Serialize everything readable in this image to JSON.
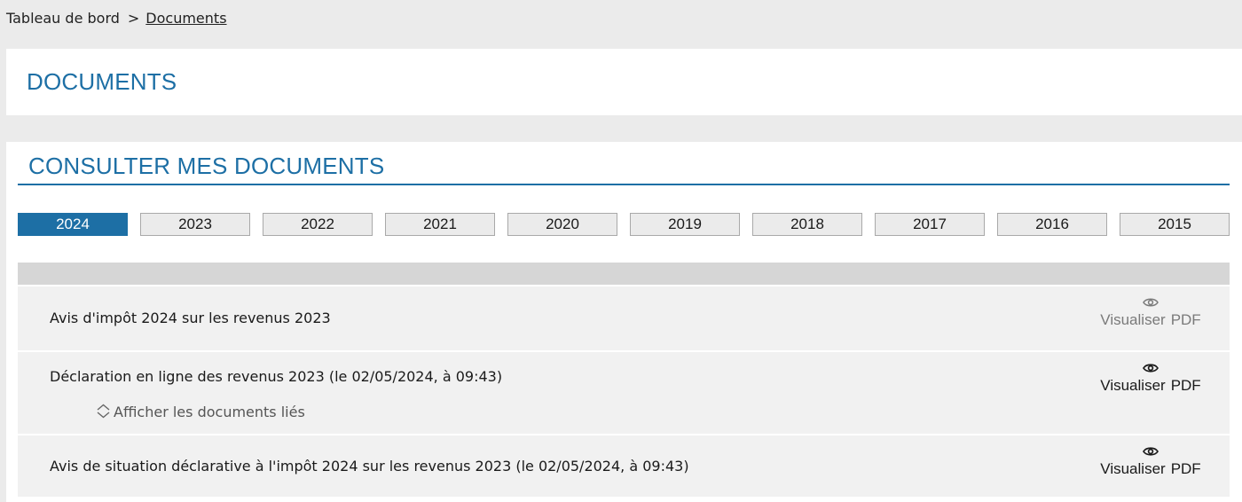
{
  "breadcrumb": {
    "home": "Tableau de bord",
    "separator": ">",
    "current": "Documents"
  },
  "page": {
    "title": "DOCUMENTS"
  },
  "section": {
    "title": "CONSULTER MES DOCUMENTS"
  },
  "years": {
    "active": "2024",
    "tabs": [
      "2024",
      "2023",
      "2022",
      "2021",
      "2020",
      "2019",
      "2018",
      "2017",
      "2016",
      "2015"
    ]
  },
  "documents": [
    {
      "title": "Avis d'impôt 2024 sur les revenus 2023",
      "action_label": "Visualiser",
      "format_label": "PDF",
      "icon": "eye-icon"
    },
    {
      "title": "Déclaration en ligne des revenus 2023 (le 02/05/2024, à 09:43)",
      "action_label": "Visualiser",
      "format_label": "PDF",
      "icon": "eye-icon",
      "related_label": "Afficher les documents liés",
      "related_icon": "expand-icon"
    },
    {
      "title": "Avis de situation déclarative à l'impôt 2024 sur les revenus 2023 (le 02/05/2024, à 09:43)",
      "action_label": "Visualiser",
      "format_label": "PDF",
      "icon": "eye-icon"
    }
  ],
  "colors": {
    "accent": "#1d6fa5",
    "page_background": "#ebebeb",
    "row_background": "#f1f1f1",
    "header_bar": "#d6d6d6"
  }
}
